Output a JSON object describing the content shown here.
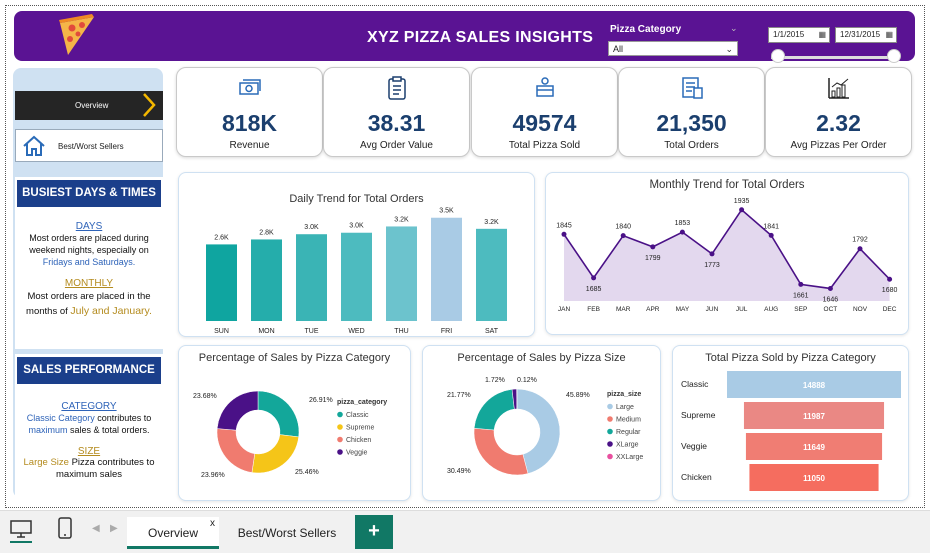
{
  "header": {
    "title": "XYZ PIZZA SALES INSIGHTS",
    "category_label": "Pizza Category",
    "category_value": "All",
    "date_start": "1/1/2015",
    "date_end": "12/31/2015"
  },
  "nav": {
    "overview": "Overview",
    "best_worst": "Best/Worst Sellers"
  },
  "busiest": {
    "heading": "BUSIEST DAYS & TIMES",
    "days_label": "DAYS",
    "days_text": "Most orders are placed during weekend nights, especially on",
    "days_highlight": "Fridays and Saturdays.",
    "monthly_label": "MONTHLY",
    "monthly_text": "Most orders are placed in the months of",
    "monthly_highlight": "July and January."
  },
  "performance": {
    "heading": "SALES PERFORMANCE",
    "category_label": "CATEGORY",
    "category_highlight": "Classic Category",
    "category_text1": "contributes to",
    "category_highlight2": "maximum",
    "category_text2": "sales & total orders.",
    "size_label": "SIZE",
    "size_highlight": "Large Size",
    "size_text": "Pizza contributes to maximum sales"
  },
  "kpis": [
    {
      "value": "818K",
      "label": "Revenue",
      "icon": "money-icon"
    },
    {
      "value": "38.31",
      "label": "Avg Order Value",
      "icon": "clipboard-icon"
    },
    {
      "value": "49574",
      "label": "Total Pizza Sold",
      "icon": "delivery-icon"
    },
    {
      "value": "21,350",
      "label": "Total Orders",
      "icon": "checklist-icon"
    },
    {
      "value": "2.32",
      "label": "Avg Pizzas Per Order",
      "icon": "growth-chart-icon"
    }
  ],
  "chart_data": [
    {
      "type": "bar",
      "title": "Daily Trend for Total Orders",
      "categories": [
        "SUN",
        "MON",
        "TUE",
        "WED",
        "THU",
        "FRI",
        "SAT"
      ],
      "values": [
        2624,
        2794,
        2973,
        3024,
        3239,
        3538,
        3158
      ],
      "labels": [
        "2.6K",
        "2.8K",
        "3.0K",
        "3.0K",
        "3.2K",
        "3.5K",
        "3.2K"
      ],
      "colors": [
        "#0fa5a0",
        "#25adab",
        "#3ab4b5",
        "#4dbbbf",
        "#6cc3cd",
        "#a9cbe5",
        "#4dbbbf"
      ]
    },
    {
      "type": "area",
      "title": "Monthly Trend for Total Orders",
      "categories": [
        "JAN",
        "FEB",
        "MAR",
        "APR",
        "MAY",
        "JUN",
        "JUL",
        "AUG",
        "SEP",
        "OCT",
        "NOV",
        "DEC"
      ],
      "values": [
        1845,
        1685,
        1840,
        1799,
        1853,
        1773,
        1935,
        1841,
        1661,
        1646,
        1792,
        1680
      ],
      "ylim": [
        1600,
        1960
      ]
    },
    {
      "type": "pie",
      "title": "Percentage of Sales by Pizza Category",
      "legend_title": "pizza_category",
      "slices": [
        {
          "name": "Classic",
          "value": 26.91,
          "label": "26.91%",
          "color": "#13a79a"
        },
        {
          "name": "Supreme",
          "value": 25.46,
          "label": "25.46%",
          "color": "#f5c518"
        },
        {
          "name": "Chicken",
          "value": 23.96,
          "label": "23.96%",
          "color": "#f07b6f"
        },
        {
          "name": "Veggie",
          "value": 23.68,
          "label": "23.68%",
          "color": "#4a1187"
        }
      ]
    },
    {
      "type": "pie",
      "title": "Percentage of Sales by Pizza Size",
      "legend_title": "pizza_size",
      "slices": [
        {
          "name": "Large",
          "value": 45.89,
          "label": "45.89%",
          "color": "#a9cbe5"
        },
        {
          "name": "Medium",
          "value": 30.49,
          "label": "30.49%",
          "color": "#f07b6f"
        },
        {
          "name": "Regular",
          "value": 21.77,
          "label": "21.77%",
          "color": "#13a79a"
        },
        {
          "name": "XLarge",
          "value": 1.72,
          "label": "1.72%",
          "color": "#4a1187"
        },
        {
          "name": "XXLarge",
          "value": 0.12,
          "label": "0.12%",
          "color": "#e8509f"
        }
      ]
    },
    {
      "type": "bar",
      "title": "Total Pizza Sold by Pizza Category",
      "categories": [
        "Classic",
        "Supreme",
        "Veggie",
        "Chicken"
      ],
      "values": [
        14888,
        11987,
        11649,
        11050
      ],
      "colors": [
        "#a9cbe5",
        "#ea8884",
        "#f07d73",
        "#f56d5f"
      ]
    }
  ],
  "tabs": {
    "overview": "Overview",
    "best_worst": "Best/Worst Sellers",
    "close": "x",
    "add": "+"
  }
}
